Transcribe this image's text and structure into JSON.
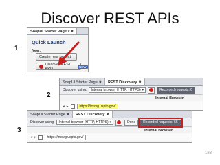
{
  "title": "Discover REST APIs",
  "steps": [
    "1",
    "2",
    "3"
  ],
  "panel1": {
    "tabs": [
      {
        "label": "SoapUI Starter Page",
        "active": true
      }
    ],
    "tab_glyphs": "▾ ✖",
    "quick_launch": "Quick Launch",
    "new_label": "New:",
    "create_project": "Create new project",
    "discover_button": "Discover REST APIs",
    "badge": "NEW"
  },
  "panel2": {
    "tabs": [
      "SoapUI Starter Page",
      "REST Discovery"
    ],
    "discover_using": "Discover using:",
    "browser": "Internal browser (HTTP, HTTPS)",
    "recorded": "Recorded requests: 0",
    "internal_browser": "Internal Browser",
    "url": "https://tmsvg.uspto.gov/"
  },
  "panel3": {
    "tabs": [
      "SoapUI Starter Page",
      "REST Discovery"
    ],
    "discover_using": "Discover using:",
    "browser": "Internal browser (HTTP, HTTPS)",
    "done": "Done",
    "recorded": "Recorded requests: 56",
    "internal_browser": "Internal Browser",
    "url": "https://tmsvg.uspto.gov/"
  },
  "page_number": "183",
  "colors": {
    "highlight_red": "#c62020",
    "url_highlight": "#fffb7a",
    "record_red": "#c91d1d"
  }
}
